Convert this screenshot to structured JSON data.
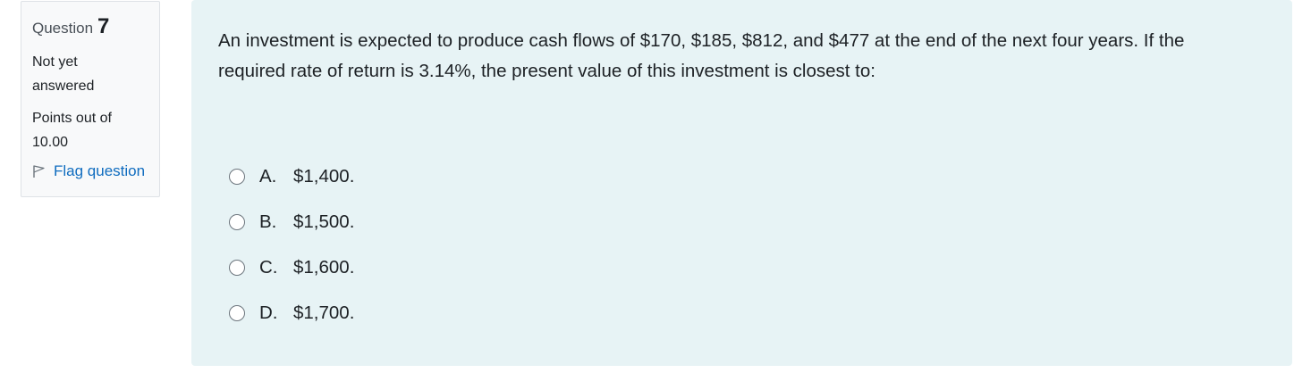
{
  "info": {
    "question_word": "Question",
    "question_number": "7",
    "state_line1": "Not yet",
    "state_line2": "answered",
    "grade_line1": "Points out of",
    "grade_line2": "10.00",
    "flag_label": "Flag question"
  },
  "question": {
    "text": "An investment is expected to produce cash flows of $170, $185, $812, and $477 at the end of the next four years. If the required rate of return is 3.14%, the present value of this investment is closest to:"
  },
  "answers": [
    {
      "letter": "A.",
      "text": "$1,400."
    },
    {
      "letter": "B.",
      "text": "$1,500."
    },
    {
      "letter": "C.",
      "text": "$1,600."
    },
    {
      "letter": "D.",
      "text": "$1,700."
    }
  ],
  "colors": {
    "content_bg": "#e7f3f5",
    "info_bg": "#f8f9fa",
    "link": "#0f6cbf"
  }
}
